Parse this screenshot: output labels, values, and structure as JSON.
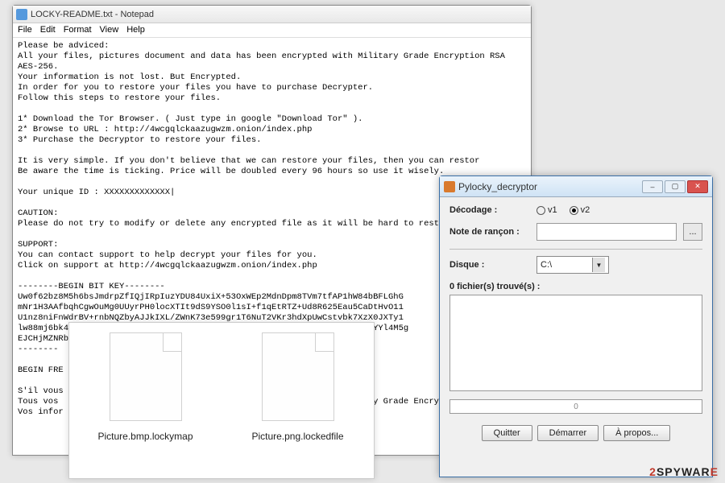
{
  "notepad": {
    "title": "LOCKY-README.txt - Notepad",
    "menu": [
      "File",
      "Edit",
      "Format",
      "View",
      "Help"
    ],
    "body": "Please be adviced:\nAll your files, pictures document and data has been encrypted with Military Grade Encryption RSA AES-256.\nYour information is not lost. But Encrypted.\nIn order for you to restore your files you have to purchase Decrypter.\nFollow this steps to restore your files.\n\n1* Download the Tor Browser. ( Just type in google \"Download Tor\" ).\n2* Browse to URL : http://4wcgqlckaazugwzm.onion/index.php\n3* Purchase the Decryptor to restore your files.\n\nIt is very simple. If you don't believe that we can restore your files, then you can restor\nBe aware the time is ticking. Price will be doubled every 96 hours so use it wisely.\n\nYour unique ID : XXXXXXXXXXXXX|\n\nCAUTION:\nPlease do not try to modify or delete any encrypted file as it will be hard to restore it.\n\nSUPPORT:\nYou can contact support to help decrypt your files for you.\nClick on support at http://4wcgqlckaazugwzm.onion/index.php\n\n--------BEGIN BIT KEY--------\nUw0f62bz8M5h6bsJmdrpZfIQjIRpIuzYDU84UxiX+53OxWEp2MdnDpm8TVm7tfAP1hW84bBFLGhG\nmNr1H3AAfbqhCgwOuMg0UUyrPH0locXTIt9dS9YSO0l1sI+f1qEtRTZ+Ud8R625Eau5CaDtHvO11\nU1nz8niFnWdrBV+rnbNQZbyAJJkIXL/ZWnK73e599gr1T6NuT2VKr3hdXpUwCstvbk7XzX0JXTy1\nlw88mj6bk4nxH7Uxj/GZEu9mgAojBAfE8WptvdAGZg+1WcZ2N2ZqgIjOeDnlauGIQZqGhmYYl4M5g\nEJCHjMZNRb1OnpibGRmOJDNAE1Cb126/GE01mvom\n--------\n\nBEGIN FRE\n\nS'il vous\nTous vos                                                              y Grade Encrypt\nVos infor"
  },
  "files": {
    "file1": "Picture.bmp.lockymap",
    "file2": "Picture.png.lockedfile"
  },
  "decryptor": {
    "title": "Pylocky_decryptor",
    "labels": {
      "decodage": "Décodage :",
      "note": "Note de rançon :",
      "disque": "Disque :",
      "found": "0 fichier(s) trouvé(s) :",
      "v1": "v1",
      "v2": "v2",
      "browse": "...",
      "disk_value": "C:\\",
      "progress": "0"
    },
    "buttons": {
      "quitter": "Quitter",
      "demarrer": "Démarrer",
      "apropos": "À propos..."
    },
    "winbtns": {
      "min": "–",
      "max": "▢",
      "close": "✕"
    }
  },
  "watermark": {
    "prefix": "2",
    "mid": "SPYWAR",
    "suffix": "E"
  }
}
